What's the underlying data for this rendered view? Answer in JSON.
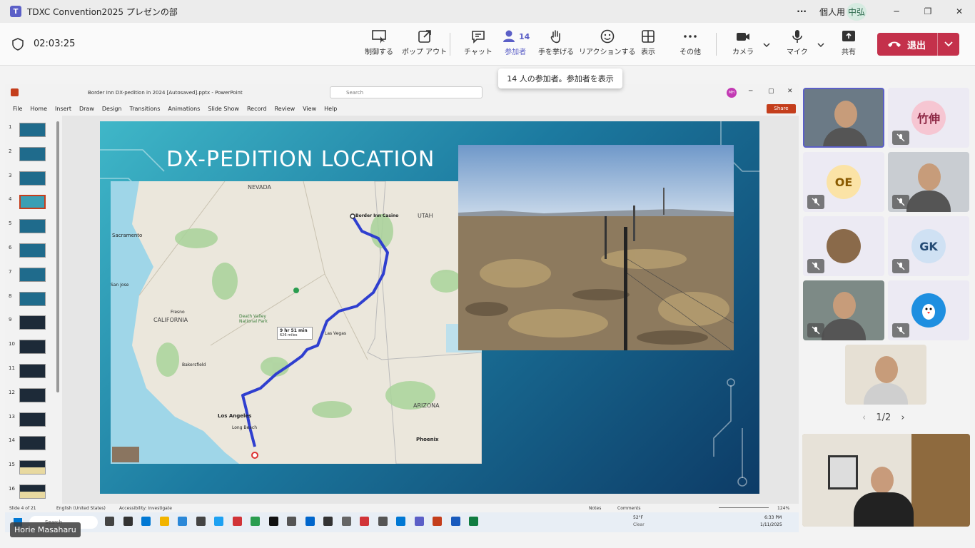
{
  "titlebar": {
    "title": "TDXC Convention2025 プレゼンの部",
    "account": "個人用",
    "user_initials": "中弘",
    "more": "···",
    "minimize": "─",
    "restore": "❐",
    "close": "✕"
  },
  "meeting": {
    "timer": "02:03:25",
    "buttons": {
      "control": "制御する",
      "popout": "ポップ アウト",
      "chat": "チャット",
      "participants": "参加者",
      "participants_count": "14",
      "raise_hand": "手を挙げる",
      "reactions": "リアクションする",
      "view": "表示",
      "more": "その他",
      "camera": "カメラ",
      "mic": "マイク",
      "share": "共有",
      "leave": "退出"
    },
    "tooltip": "14 人の参加者。参加者を表示"
  },
  "powerpoint": {
    "filename": "Border Inn DX-pedition in 2024 [Autosaved].pptx  -  PowerPoint",
    "search_placeholder": "Search",
    "user_initials": "MH",
    "share_button": "Share",
    "ribbon_tabs": [
      "File",
      "Home",
      "Insert",
      "Draw",
      "Design",
      "Transitions",
      "Animations",
      "Slide Show",
      "Record",
      "Review",
      "View",
      "Help"
    ],
    "thumb_numbers": [
      "1",
      "2",
      "3",
      "4",
      "5",
      "6",
      "7",
      "8",
      "9",
      "10",
      "11",
      "12",
      "13",
      "14",
      "15",
      "16"
    ],
    "status": {
      "slide": "Slide 4 of 21",
      "language": "English (United States)",
      "accessibility": "Accessibility: Investigate",
      "notes": "Notes",
      "comments": "Comments",
      "zoom": "124%"
    },
    "taskbar": {
      "search": "Search",
      "weather_temp": "52°F",
      "weather_desc": "Clear",
      "time": "6:33 PM",
      "date": "1/11/2025"
    }
  },
  "slide": {
    "title": "DX-PEDITION LOCATION",
    "map_labels": {
      "nevada": "NEVADA",
      "utah": "UTAH",
      "california": "CALIFORNIA",
      "arizona": "ARIZONA",
      "border_inn": "Border Inn Casino",
      "route_time": "9 hr 51 min",
      "route_dist": "626 miles",
      "sacramento": "Sacramento",
      "las_vegas": "Las Vegas",
      "los_angeles": "Los Angeles",
      "phoenix": "Phoenix",
      "bakersfield": "Bakersfield",
      "fresno": "Fresno",
      "death_valley": "Death Valley National Park",
      "long_beach": "Long Beach",
      "san_jose": "San Jose"
    }
  },
  "gallery": {
    "pager": "1/2",
    "tiles": [
      {
        "type": "video"
      },
      {
        "type": "avatar",
        "initials": "竹伸",
        "muted": true
      },
      {
        "type": "avatar",
        "initials": "OE",
        "muted": true
      },
      {
        "type": "video",
        "muted": true
      },
      {
        "type": "avatar-photo",
        "muted": true
      },
      {
        "type": "avatar",
        "initials": "GK",
        "muted": true
      },
      {
        "type": "video",
        "muted": true
      },
      {
        "type": "avatar-icon",
        "muted": true
      },
      {
        "type": "video"
      }
    ],
    "presenter_name": "Horie Masaharu"
  }
}
